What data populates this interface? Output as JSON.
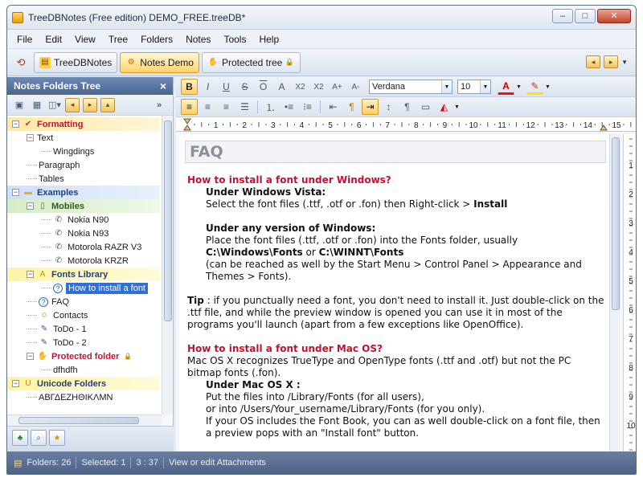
{
  "window": {
    "title": "TreeDBNotes (Free edition) DEMO_FREE.treeDB*",
    "controls": {
      "minimize": "–",
      "maximize": "□",
      "close": "✕"
    }
  },
  "menu": [
    "File",
    "Edit",
    "View",
    "Tree",
    "Folders",
    "Notes",
    "Tools",
    "Help"
  ],
  "tabs": [
    {
      "label": "TreeDBNotes",
      "icon": "book-icon",
      "active": false
    },
    {
      "label": "Notes Demo",
      "icon": "gear-icon",
      "active": true
    },
    {
      "label": "Protected tree",
      "icon": "hand-icon",
      "active": false
    }
  ],
  "sidebar": {
    "title": "Notes Folders Tree",
    "close": "×",
    "more": "»",
    "tree": [
      {
        "label": "Formatting",
        "level": 0,
        "expander": "−",
        "bold": true,
        "color": "#c8102e",
        "icon": "check-icon",
        "hl": "orange"
      },
      {
        "label": "Text",
        "level": 1,
        "expander": "−"
      },
      {
        "label": "Wingdings",
        "level": 2
      },
      {
        "label": "Paragraph",
        "level": 1
      },
      {
        "label": "Tables",
        "level": 1
      },
      {
        "label": "Examples",
        "level": 0,
        "expander": "−",
        "bold": true,
        "color": "#1f3f80",
        "icon": "folder-icon",
        "hl": "blue"
      },
      {
        "label": "Mobiles",
        "level": 1,
        "expander": "−",
        "bold": true,
        "color": "#2d5a1b",
        "icon": "mobile-icon",
        "hl": "green"
      },
      {
        "label": "Nokia N90",
        "level": 2,
        "icon": "phone-icon"
      },
      {
        "label": "Nokia N93",
        "level": 2,
        "icon": "phone-icon"
      },
      {
        "label": "Motorola RAZR V3",
        "level": 2,
        "icon": "phone-icon"
      },
      {
        "label": "Motorola KRZR",
        "level": 2,
        "icon": "phone-icon"
      },
      {
        "label": "Fonts Library",
        "level": 1,
        "expander": "−",
        "bold": true,
        "color": "#1f3f80",
        "icon": "font-icon",
        "hl": "yellow"
      },
      {
        "label": "How to install a font",
        "level": 2,
        "icon": "help-icon",
        "selected": true
      },
      {
        "label": "FAQ",
        "level": 1,
        "icon": "help-icon"
      },
      {
        "label": "Contacts",
        "level": 1,
        "icon": "contacts-icon"
      },
      {
        "label": "ToDo - 1",
        "level": 1,
        "icon": "pencil-icon"
      },
      {
        "label": "ToDo - 2",
        "level": 1,
        "icon": "pencil-icon"
      },
      {
        "label": "Protected folder",
        "level": 1,
        "expander": "−",
        "bold": true,
        "color": "#c8102e",
        "icon": "hand-icon"
      },
      {
        "label": "dfhdfh",
        "level": 2
      },
      {
        "label": "Unicode Folders",
        "level": 0,
        "expander": "−",
        "bold": true,
        "color": "#1f3f80",
        "icon": "unicode-icon",
        "hl": "yellow"
      },
      {
        "label": "ΑΒΓΔΕΖΗΘΙΚΛΜΝ",
        "level": 1
      }
    ]
  },
  "format_toolbar": {
    "font_name": "Verdana",
    "font_size": "10",
    "buttons": [
      "B",
      "I",
      "U",
      "S",
      "O",
      "A",
      "X2",
      "X2",
      "A+",
      "A-"
    ]
  },
  "ruler_numbers": [
    "1",
    "2",
    "3",
    "4",
    "5",
    "6",
    "7",
    "8",
    "9",
    "10",
    "11",
    "12",
    "13",
    "14",
    "15"
  ],
  "document": {
    "title": "FAQ",
    "h1": "How to install a font under Windows?",
    "win_vista_head": "Under Windows Vista:",
    "win_vista_text": "Select the font files (.ttf, .otf or .fon) then Right-click > ",
    "win_vista_install": "Install",
    "win_any_head": "Under any version of Windows:",
    "win_any_text": "Place the font files (.ttf, .otf or .fon) into the Fonts folder, usually",
    "path1": "C:\\Windows\\Fonts",
    "or_text": " or ",
    "path2": "C:\\WINNT\\Fonts",
    "reach_text": " (can be reached as well by the Start Menu > Control Panel > Appearance and Themes > Fonts).",
    "tip_label": "Tip",
    "tip_text": " : if you punctually need a font, you don't need to install it. Just double-click on the .ttf file, and while the preview window is opened you can use it in most of the programs you'll launch (apart from a few exceptions like OpenOffice).",
    "h2": "How to install a font under Mac OS?",
    "mac_text": "Mac OS X recognizes TrueType and OpenType fonts (.ttf and .otf) but not the PC bitmap fonts (.fon).",
    "mac_head": "Under Mac OS X :",
    "mac_line1": "Put the files into /Library/Fonts (for all users),",
    "mac_line2": "or into /Users/Your_username/Library/Fonts (for you only).",
    "mac_line3": "If your OS includes the Font Book, you can as well double-click on a font file, then a preview pops with an \"Install font\" button."
  },
  "status": {
    "folders": "Folders: 26",
    "selected": "Selected: 1",
    "time": "3 : 37",
    "attachments": "View or edit Attachments"
  },
  "colors": {
    "accent_orange": "#ffd46c",
    "heading_red": "#c8102e",
    "panel_header": "#4b6593",
    "selection": "#2f6fd6"
  }
}
